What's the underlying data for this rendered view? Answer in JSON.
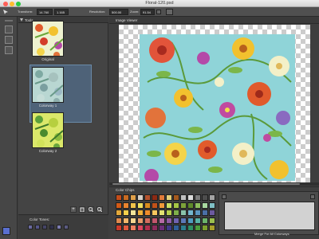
{
  "window": {
    "title": "Floral-120.psd"
  },
  "optionbar": {
    "transform_label": "Transform:",
    "transform_value": "14.760",
    "transform_value2": "1.165",
    "resolution_label": "Resolution:",
    "resolution_value": "500.00 ppi",
    "zoom_label": "Zoom:",
    "zoom_value": "91.54"
  },
  "panels": {
    "tools_title": "Tools",
    "viewer_title": "Image Viewer",
    "chips_title": "Color Chips",
    "tones_title": "Color Tones:",
    "mix_label": "Merge For All Colorways"
  },
  "colorways": [
    {
      "label": "Original",
      "bg": "#eef2d0"
    },
    {
      "label": "Colorway 1",
      "bg": "#b9d7d2"
    },
    {
      "label": "Colorway 2",
      "bg": "#dbe86a"
    }
  ],
  "buttons": {
    "add": "+",
    "delete": "🗑",
    "zoom_in": "+",
    "zoom_out": "−"
  },
  "tones": [
    "#6a6aa0",
    "#555588",
    "#444466",
    "#2f2f4a",
    "#7b7bb0",
    "#5a5a80"
  ],
  "chips": [
    [
      "#c44d1a",
      "#c96b22",
      "#e0a04a",
      "#d6d0c8",
      "#b5522d",
      "#8c2a14",
      "#e07b3a",
      "#e3d07a",
      "#a55a1d",
      "#c0c0c0",
      "#dcdcdc",
      "#7a7a7a",
      "#4d4d4d",
      "#a3a3a3"
    ],
    [
      "#d35a16",
      "#e8842f",
      "#f0c24a",
      "#efe060",
      "#d98e1e",
      "#c25219",
      "#f09a3a",
      "#c9e063",
      "#a6c745",
      "#7da23a",
      "#5f8a2b",
      "#8fbf5d",
      "#a9d9a0",
      "#7fc0c5"
    ],
    [
      "#e4a93b",
      "#f4d04c",
      "#f2e59a",
      "#f0b23a",
      "#ef8c2b",
      "#f7c75e",
      "#e2e272",
      "#b5cf4b",
      "#7eb04a",
      "#89c3a9",
      "#74b7cf",
      "#5b96c0",
      "#4a6fa6",
      "#6c5aa0"
    ],
    [
      "#e08a4f",
      "#f2b66b",
      "#f6d690",
      "#e89a6a",
      "#d46c5e",
      "#c2576d",
      "#b56aa5",
      "#8d5ca8",
      "#6f62b1",
      "#5c79b8",
      "#4f9bbf",
      "#57b2a7",
      "#6bb36c",
      "#9bbf4f"
    ],
    [
      "#cc3a2a",
      "#e05a3f",
      "#f08060",
      "#d9465e",
      "#b2304d",
      "#8c2c5c",
      "#6c2e7a",
      "#3f3b8a",
      "#2f5f9a",
      "#2d7f8f",
      "#2e8f63",
      "#4b9b3a",
      "#7da02e",
      "#a8a02a"
    ]
  ]
}
